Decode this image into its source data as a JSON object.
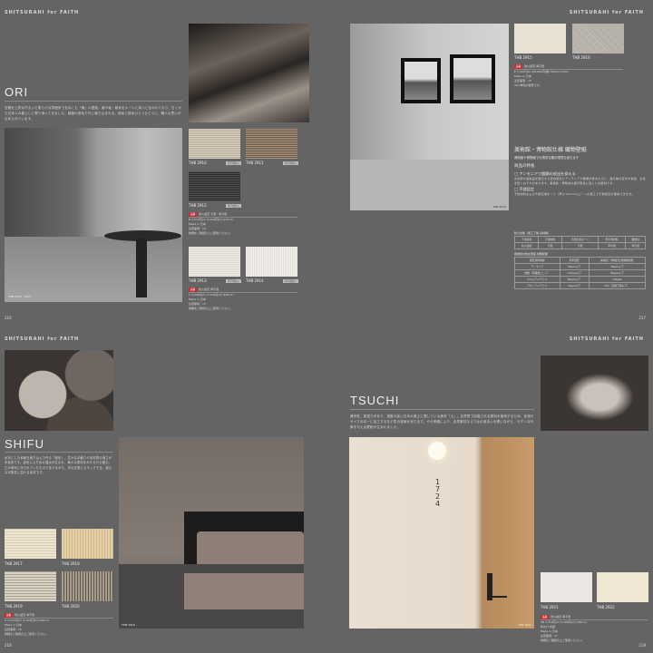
{
  "header": "SHITSURAHI for FAITH",
  "pages": {
    "p216": {
      "title": "ORI",
      "text": "空間を上質な佇まいと柔らかな雰囲気で包みこむ「織」の壁紙。襖や紙・絹糸をルーツに持つと言われており、古くから日本人の暮らしに寄り添ってきました。織機の音色で丹に織り込まれる、経糸と緯糸ひとつひとつに、職人の思いが込められています。",
      "photo_caption": "THB 2910 · 2913",
      "swatches": [
        {
          "code": "THB 2910"
        },
        {
          "code": "THB 2911"
        },
        {
          "code": "THB 2912"
        },
        {
          "code": "THB 2913"
        },
        {
          "code": "THB 2914"
        }
      ],
      "info1": [
        "防火認定 不燃・準不燃",
        "D 3,070円/m (3,100円/m)  970cm",
        "Made in 日本",
        "注意事項：14",
        "詳細をご確認の上ご使用ください。"
      ],
      "info2": [
        "防火認定 準不燃",
        "C 3,240円/m (3,100円/m)  930cm",
        "Made in 日本",
        "注意事項：14",
        "詳細をご確認の上ご使用ください。"
      ],
      "badge": "品番",
      "tag": "準不燃防火",
      "page": "216"
    },
    "p217": {
      "photo_caption": "THB 2915",
      "swatches": [
        {
          "code": "THB 2915"
        },
        {
          "code": "THB 2916"
        }
      ],
      "info": [
        "防火認定 準不燃",
        "E 3,370円/m (60,000円/巻)  930cm×30m",
        "Made in 日本",
        "注意事項：15",
        "30m単位の販売です。"
      ],
      "museum_title": "美術館・博物館仕様 織物壁紙",
      "museum_sub": "美術館や博物館での適切な展示環境を保ちます",
      "features": "商品の特長",
      "f1": "□ アンモニアで酸類の放出を抑える",
      "f1_text": "文化財や美術品を展示する室内環境にアンモニアや酸類が含まれると、展示物の変化や退色、劣化を招くおそれがあります。美術館・博物館の展示環境に適した内装材です。",
      "f2": "□ 不燃認定",
      "f2_text": "不燃材料および不燃石膏ボード（厚さ12mm以上）への施工で不燃認定が取得できます。",
      "table1_title": "防火性能（施工下地 基材等）",
      "table1": [
        [
          "下地基材",
          "不燃材料",
          "不燃石膏ボード",
          "準不燃材料",
          "難燃材"
        ],
        [
          "防火性能",
          "不燃",
          "不燃",
          "準不燃",
          "準不燃"
        ]
      ],
      "table2_title": "各物質の放出濃度 試験結果",
      "table2": [
        [
          "測定対象物質",
          "基準濃度",
          "美術館・博物館仕様織物壁紙"
        ],
        [
          "アンモニア",
          "30ppb以下",
          "30ppb以下"
        ],
        [
          "酢酸（有機酸として）",
          "170ppb以下",
          "80ppb以下"
        ],
        [
          "ホルムアルデヒド",
          "80ppb以下",
          "<46ppb"
        ],
        [
          "アセトアルデヒド",
          "30ppb以下",
          "N.D（定量下限以下）"
        ]
      ],
      "page": "217"
    },
    "p218": {
      "title": "SHIFU",
      "text": "糸状にした和紙を織り込んで作る「紙布」。豊かな手触りや素材感の強さが印象的です。染色により色の濃淡が生まれ、様々な表情をみせるのも魅力。江戸時代に作られていたものでありながら、洋の空間にもマッチする、新たな可能性に溢れる素材です。",
      "photo_caption": "THB 2916",
      "swatches": [
        {
          "code": "THB 2917"
        },
        {
          "code": "THB 2918"
        },
        {
          "code": "THB 2919"
        },
        {
          "code": "THB 2920"
        }
      ],
      "info": [
        "防火認定 準不燃",
        "D 3,070円/m (3,300円/m)  930cm",
        "Made in 日本",
        "注意事項：16",
        "詳細をご確認の上ご使用ください。"
      ],
      "page": "218"
    },
    "p219": {
      "title": "TSUCHI",
      "text": "通気性、保湿力があり、湿度の高い日本の風土に適している素材「土」。自然界で採取される原料を使用するため、色相やサイズを均一に加工するなど匠の技術が光ります。その研鑽により、自然素材ならではの風合いを纏いながら、モダンな印象を与える壁紙が生まれました。",
      "door_number": "1724",
      "photo_caption": "THB 2922",
      "swatches": [
        {
          "code": "THB 2921"
        },
        {
          "code": "THB 2922"
        }
      ],
      "info": [
        "防火認定 準不燃",
        "AB 1,310円/m (1,300円/m)  930cm",
        "防かび 抗菌",
        "Made in 日本",
        "注意事項：17",
        "詳細をご確認の上ご使用ください。"
      ],
      "page": "219"
    }
  }
}
